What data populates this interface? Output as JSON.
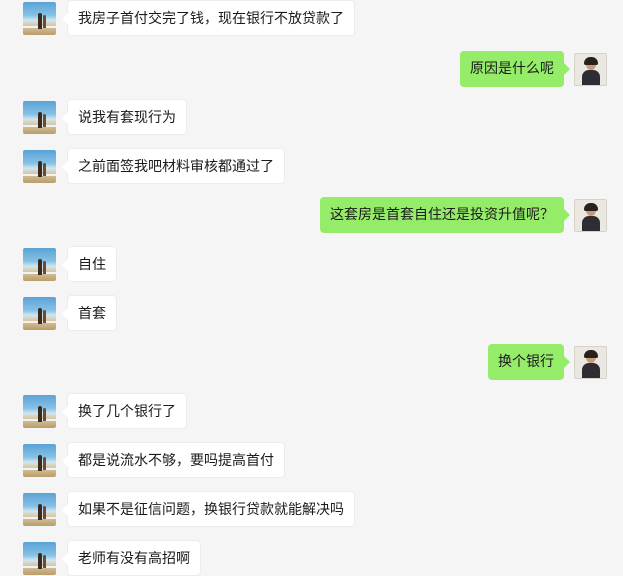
{
  "messages": [
    {
      "side": "left",
      "text": "我房子首付交完了钱，现在银行不放贷款了"
    },
    {
      "side": "right",
      "text": "原因是什么呢"
    },
    {
      "side": "left",
      "text": "说我有套现行为"
    },
    {
      "side": "left",
      "text": "之前面签我吧材料审核都通过了"
    },
    {
      "side": "right",
      "text": "这套房是首套自住还是投资升值呢？"
    },
    {
      "side": "left",
      "text": "自住"
    },
    {
      "side": "left",
      "text": "首套"
    },
    {
      "side": "right",
      "text": "换个银行"
    },
    {
      "side": "left",
      "text": "换了几个银行了"
    },
    {
      "side": "left",
      "text": "都是说流水不够，要吗提高首付"
    },
    {
      "side": "left",
      "text": "如果不是征信问题，换银行贷款就能解决吗"
    },
    {
      "side": "left",
      "text": "老师有没有高招啊"
    }
  ],
  "colors": {
    "background": "#f5f5f5",
    "incoming_bubble": "#ffffff",
    "outgoing_bubble": "#95ec69"
  }
}
